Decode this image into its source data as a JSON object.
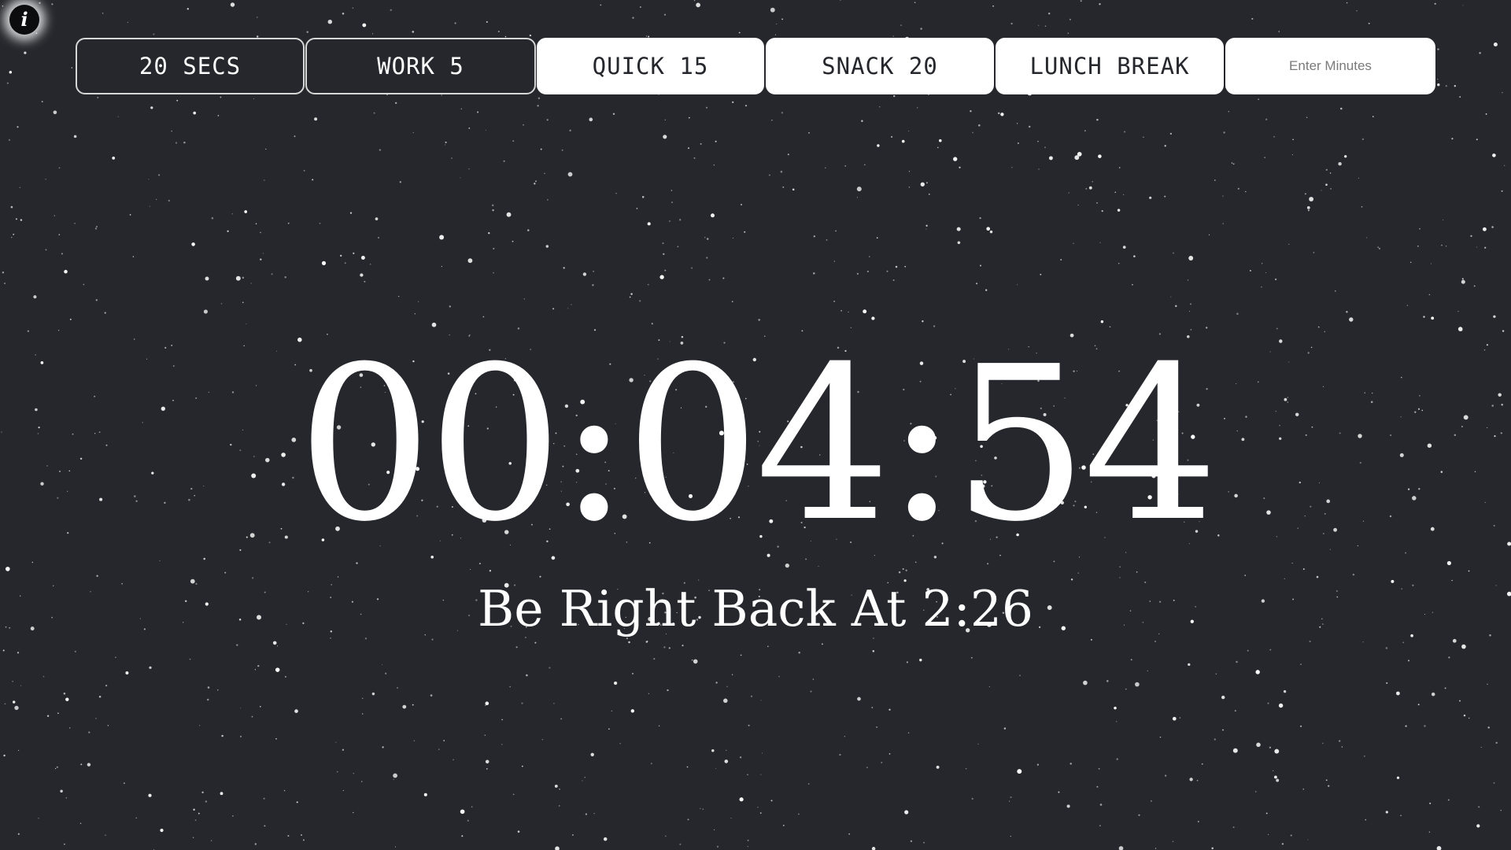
{
  "info_button": {
    "glyph": "i",
    "icon": "info-icon"
  },
  "presets": [
    {
      "label": "20 SECS",
      "style": "dark"
    },
    {
      "label": "WORK 5",
      "style": "dark"
    },
    {
      "label": "QUICK 15",
      "style": "light"
    },
    {
      "label": "SNACK 20",
      "style": "light"
    },
    {
      "label": "LUNCH BREAK",
      "style": "light"
    }
  ],
  "minutes_input": {
    "placeholder": "Enter Minutes",
    "value": ""
  },
  "timer": {
    "display": "00:04:54",
    "return_message": "Be Right Back At 2:26"
  },
  "colors": {
    "background": "#25272c",
    "text": "#ffffff",
    "button_light": "#ffffff",
    "button_dark": "#25272c"
  }
}
